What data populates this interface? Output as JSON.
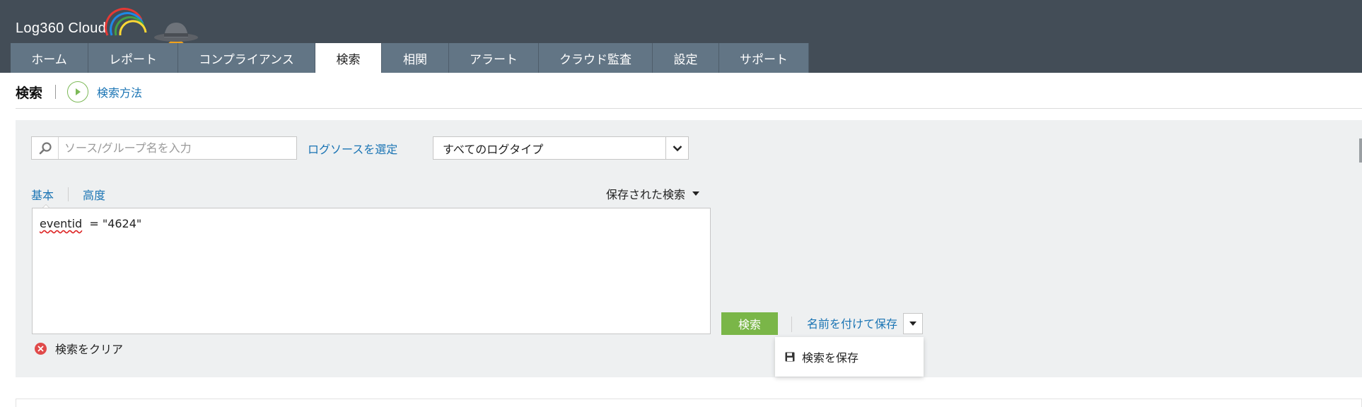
{
  "app": {
    "logo_text": "Log360  Cloud",
    "logo_icon": "rainbow-arcs-logo",
    "mascot_icon": "spy-mascot-icon"
  },
  "nav": {
    "tabs": [
      {
        "label": "ホーム",
        "active": false
      },
      {
        "label": "レポート",
        "active": false
      },
      {
        "label": "コンプライアンス",
        "active": false
      },
      {
        "label": "検索",
        "active": true
      },
      {
        "label": "相関",
        "active": false
      },
      {
        "label": "アラート",
        "active": false
      },
      {
        "label": "クラウド監査",
        "active": false
      },
      {
        "label": "設定",
        "active": false
      },
      {
        "label": "サポート",
        "active": false
      }
    ]
  },
  "page": {
    "title": "検索",
    "howto_label": "検索方法"
  },
  "search": {
    "source_placeholder": "ソース/グループ名を入力",
    "source_value": "",
    "select_log_source_label": "ログソースを選定",
    "log_type_selected": "すべてのログタイプ",
    "mode_tabs": {
      "basic": "基本",
      "advanced": "高度"
    },
    "saved_searches_label": "保存された検索",
    "query_field": "eventid",
    "query_rest": "  = \"4624\"",
    "clear_label": "検索をクリア",
    "search_button": "検索",
    "save_as_label": "名前を付けて保存",
    "save_menu_item": "検索を保存"
  },
  "colors": {
    "header_bg": "#434d57",
    "nav_tab_bg": "#627585",
    "link": "#1a74b4",
    "search_button": "#7ab648",
    "panel_bg": "#eef0f1",
    "clear_icon": "#e04a4a"
  }
}
